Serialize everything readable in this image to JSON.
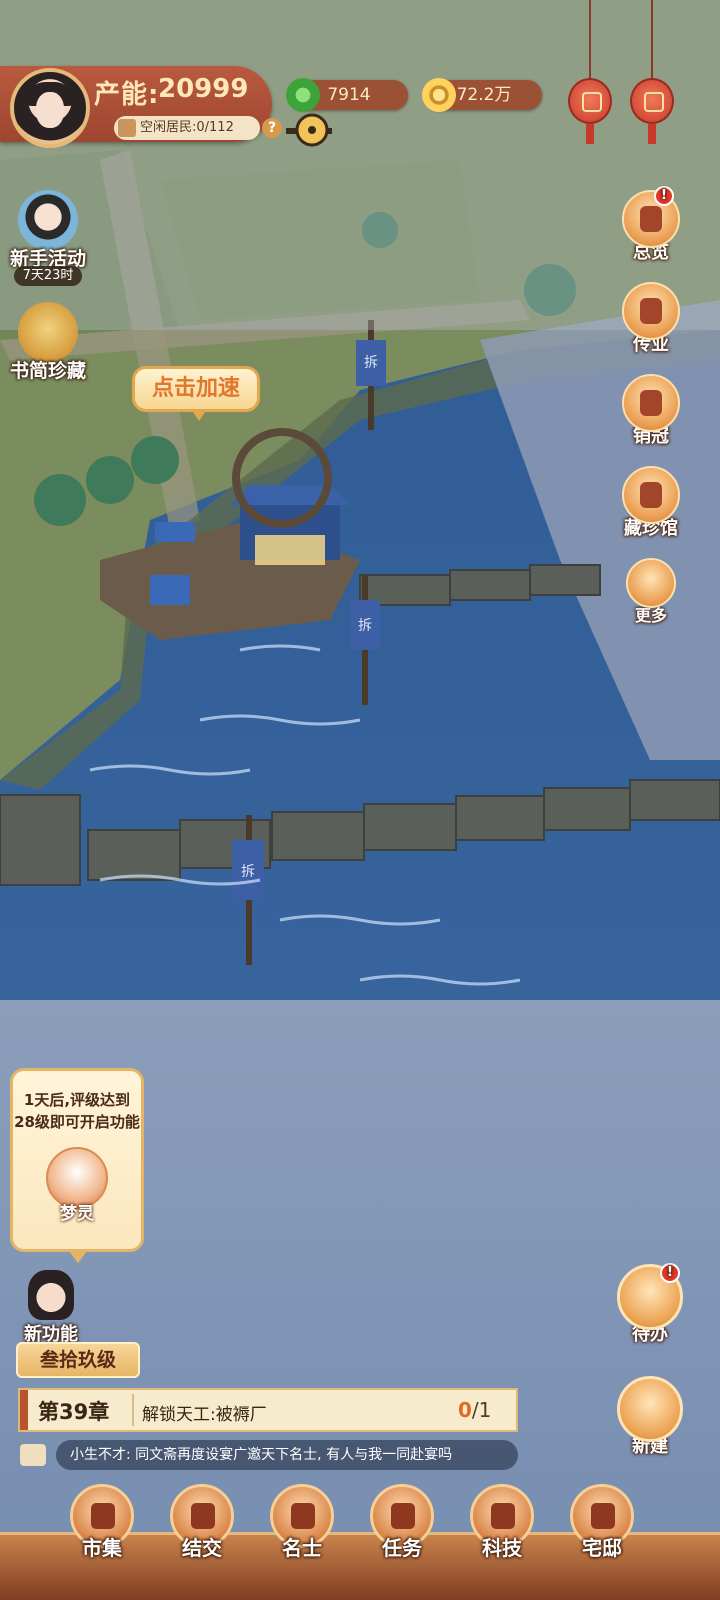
{
  "header": {
    "production_label": "产能:",
    "production_value": "20999",
    "idle_residents": "空闲居民:0/112",
    "help": "?",
    "jade": "7914",
    "gold": "72.2万"
  },
  "left_events": {
    "newbie_label": "新手活动",
    "newbie_timer": "7天23时",
    "bamboo_label": "书简珍藏"
  },
  "map": {
    "speed_up_bubble": "点击加速",
    "sign_text": "拆"
  },
  "right_menu": [
    {
      "label": "总览",
      "badge": "!"
    },
    {
      "label": "传业",
      "badge": ""
    },
    {
      "label": "销冠",
      "badge": ""
    },
    {
      "label": "藏珍馆",
      "badge": ""
    },
    {
      "label": "更多",
      "badge": ""
    }
  ],
  "unlock_card": {
    "line1": "1天后,评级达到",
    "line2": "28级即可开启功能",
    "name": "梦灵"
  },
  "new_feature_label": "新功能",
  "level_label": "叁拾玖级",
  "task": {
    "chapter": "第39章",
    "description": "解锁天工:被褥厂",
    "progress_done": "0",
    "progress_total": "/1"
  },
  "chat_message": "小生不才: 同文斋再度设宴广邀天下名士, 有人与我一同赴宴吗",
  "right_bottom": {
    "todo_label": "待办",
    "todo_badge": "!",
    "build_label": "新建"
  },
  "bottom_nav": [
    {
      "label": "市集"
    },
    {
      "label": "结交"
    },
    {
      "label": "名士"
    },
    {
      "label": "任务"
    },
    {
      "label": "科技"
    },
    {
      "label": "宅邸"
    }
  ]
}
